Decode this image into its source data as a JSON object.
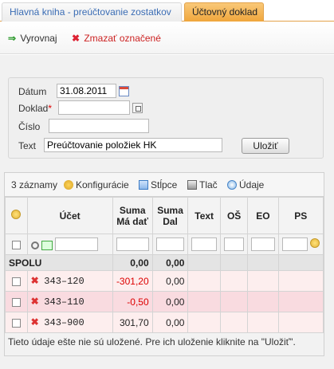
{
  "tabs": {
    "inactive": "Hlavná kniha - preúčtovanie zostatkov",
    "active": "Účtovný doklad"
  },
  "toolbar": {
    "balance_label": "Vyrovnaj",
    "delete_label": "Zmazať označené"
  },
  "form": {
    "date_label": "Dátum",
    "date_value": "31.08.2011",
    "doc_label": "Doklad",
    "doc_required_mark": "*",
    "doc_value": "",
    "number_label": "Číslo",
    "number_value": "",
    "text_label": "Text",
    "text_value": "Preúčtovanie položiek HK",
    "save_label": "Uložiť"
  },
  "grid_toolbar": {
    "count_label": "3 záznamy",
    "config_label": "Konfigurácie",
    "columns_label": "Stĺpce",
    "print_label": "Tlač",
    "data_label": "Údaje"
  },
  "columns": {
    "account": "Účet",
    "debit": "Suma Má dať",
    "credit": "Suma Dal",
    "text": "Text",
    "os": "OŠ",
    "eo": "EO",
    "ps": "PS"
  },
  "summary": {
    "label": "SPOLU",
    "debit": "0,00",
    "credit": "0,00"
  },
  "rows": [
    {
      "account": "343–120",
      "debit": "-301,20",
      "credit": "0,00"
    },
    {
      "account": "343–110",
      "debit": "-0,50",
      "credit": "0,00"
    },
    {
      "account": "343–900",
      "debit": "301,70",
      "credit": "0,00"
    }
  ],
  "footnote": "Tieto údaje ešte nie sú uložené. Pre ich uloženie kliknite na \"Uložiť\"."
}
